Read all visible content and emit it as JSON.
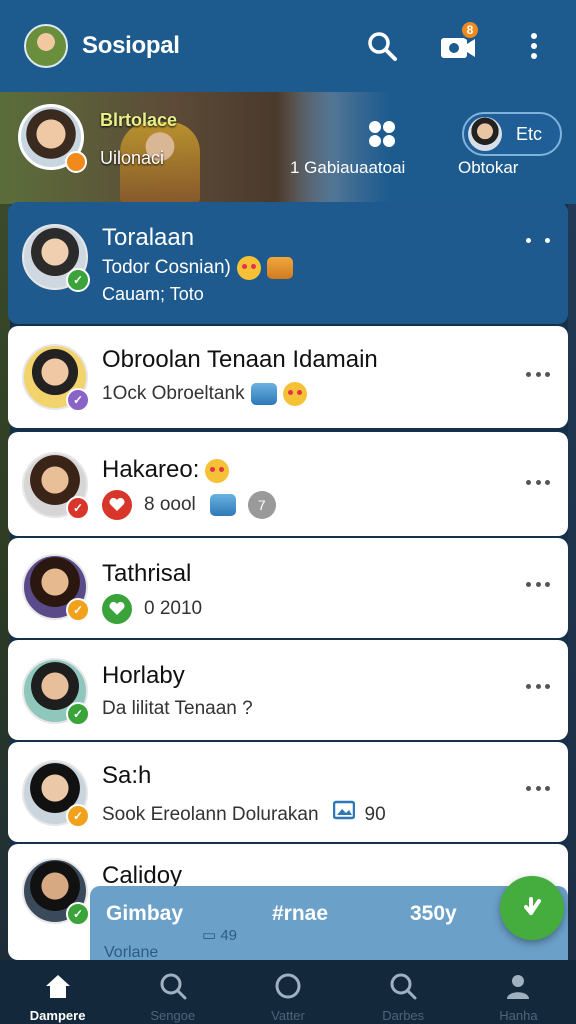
{
  "app": {
    "title": "Sosiopal",
    "notification_count": "8"
  },
  "banner": {
    "title": "Blrtolace",
    "subtitle": "Uilonaci",
    "middle_label": "1 Gabiauaatoai",
    "pill_text": "Etc",
    "pill_label": "Obtokar"
  },
  "chats": [
    {
      "name": "Toralaan",
      "preview": "Todor Cosnian)",
      "line2": "Cauam; Toto",
      "active": true,
      "status_color": "#3aa33a"
    },
    {
      "name": "Obroolan Tenaan Idamain",
      "preview": "1Ock Obroeltank",
      "status_color": "#8a63c7"
    },
    {
      "name": "Hakareo:",
      "count": "8 oool",
      "badge": "7",
      "status_color": "#d9362b"
    },
    {
      "name": "Tathrisal",
      "count": "0 2010",
      "status_color": "#f0a21d"
    },
    {
      "name": "Horlaby",
      "preview": "Da lilitat Tenaan ?",
      "status_color": "#3aa33a"
    },
    {
      "name": "Sa:h",
      "preview": "Sook Ereolann Dolurakan",
      "count": "90",
      "status_color": "#f0a21d"
    },
    {
      "name": "Calidoy",
      "status_color": "#3aa33a"
    }
  ],
  "composer": {
    "a": "Gimbay",
    "b": "#rnae",
    "c": "350y",
    "d": "49",
    "e": "Vorlane"
  },
  "nav": [
    {
      "label": "Dampere"
    },
    {
      "label": "Sengoe"
    },
    {
      "label": "Vatter"
    },
    {
      "label": "Darbes"
    },
    {
      "label": "Hanha"
    }
  ]
}
